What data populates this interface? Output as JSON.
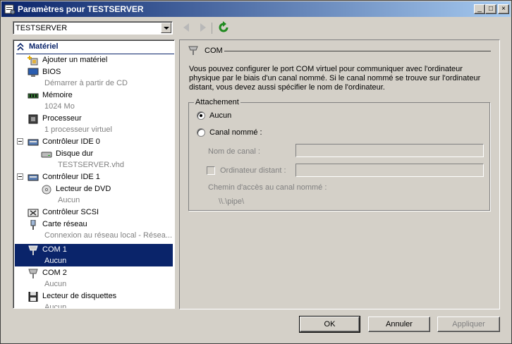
{
  "window": {
    "title": "Paramètres pour TESTSERVER"
  },
  "titlebar_buttons": {
    "min": "_",
    "max": "□",
    "close": "×"
  },
  "toolbar": {
    "vm_selected": "TESTSERVER"
  },
  "tree": {
    "header": "Matériel",
    "items": [
      {
        "label": "Ajouter un matériel",
        "sub": ""
      },
      {
        "label": "BIOS",
        "sub": "Démarrer à partir de CD"
      },
      {
        "label": "Mémoire",
        "sub": "1024 Mo"
      },
      {
        "label": "Processeur",
        "sub": "1 processeur virtuel"
      },
      {
        "label": "Contrôleur IDE 0",
        "sub": ""
      },
      {
        "label": "Disque dur",
        "sub": "TESTSERVER.vhd"
      },
      {
        "label": "Contrôleur IDE 1",
        "sub": ""
      },
      {
        "label": "Lecteur de DVD",
        "sub": "Aucun"
      },
      {
        "label": "Contrôleur SCSI",
        "sub": ""
      },
      {
        "label": "Carte réseau",
        "sub": "Connexion au réseau local - Résea..."
      },
      {
        "label": "COM 1",
        "sub": "Aucun"
      },
      {
        "label": "COM 2",
        "sub": "Aucun"
      },
      {
        "label": "Lecteur de disquettes",
        "sub": "Aucun"
      }
    ]
  },
  "content": {
    "section_title": "COM",
    "description": "Vous pouvez configurer le port COM virtuel pour communiquer avec l'ordinateur physique par le biais d'un canal nommé. Si le canal nommé se trouve sur l'ordinateur distant, vous devez aussi spécifier le nom de l'ordinateur.",
    "group_title": "Attachement",
    "radio_none": "Aucun",
    "radio_named": "Canal nommé :",
    "pipe_name_label": "Nom de canal :",
    "remote_computer_label": "Ordinateur distant :",
    "pipe_path_label": "Chemin d'accès au canal nommé :",
    "pipe_path_value": "\\\\.\\pipe\\"
  },
  "buttons": {
    "ok": "OK",
    "cancel": "Annuler",
    "apply": "Appliquer"
  }
}
